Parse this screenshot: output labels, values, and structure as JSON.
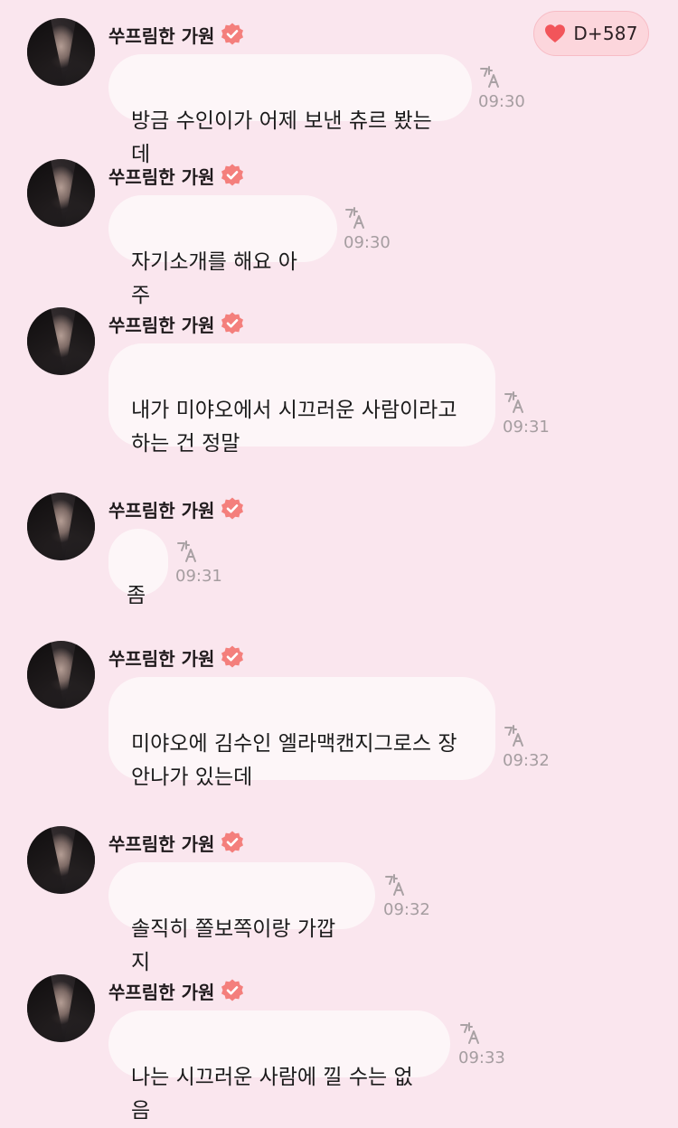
{
  "dday": {
    "label": "D+587",
    "icon": "heart-icon",
    "color": "#f2555a"
  },
  "sender": {
    "name": "쑤프림한 가원",
    "badge_icon": "verified-badge-icon",
    "badge_color": "#f47f7c"
  },
  "messages": [
    {
      "text": "방금 수인이가 어제 보낸 츄르 봤는데",
      "time": "09:30"
    },
    {
      "text": "자기소개를 해요 아주",
      "time": "09:30"
    },
    {
      "text": "내가 미야오에서 시끄러운 사람이라고\n하는 건 정말",
      "time": "09:31"
    },
    {
      "text": "좀",
      "time": "09:31"
    },
    {
      "text": "미야오에 김수인 엘라맥캔지그로스 장\n안나가 있는데",
      "time": "09:32"
    },
    {
      "text": "솔직히 쫄보쪽이랑 가깝지",
      "time": "09:32"
    },
    {
      "text": "나는 시끄러운 사람에 낄 수는 없음",
      "time": "09:33"
    }
  ]
}
